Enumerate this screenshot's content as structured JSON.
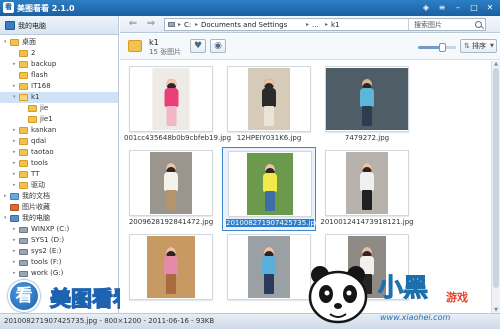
{
  "app": {
    "title": "美图看看 2.1.0",
    "logo_text": "看"
  },
  "window_controls": [
    {
      "name": "skin-icon",
      "glyph": "◈"
    },
    {
      "name": "menu-icon",
      "glyph": "≡"
    },
    {
      "name": "minimize-icon",
      "glyph": "–"
    },
    {
      "name": "maximize-icon",
      "glyph": "□"
    },
    {
      "name": "close-icon",
      "glyph": "✕"
    }
  ],
  "sidebar": {
    "header": "我的电脑",
    "tree": [
      {
        "label": "桌面",
        "depth": 0,
        "expander": "▾",
        "icon": "folder"
      },
      {
        "label": "2",
        "depth": 1,
        "expander": "",
        "icon": "folder"
      },
      {
        "label": "backup",
        "depth": 1,
        "expander": "▸",
        "icon": "folder"
      },
      {
        "label": "flash",
        "depth": 1,
        "expander": "",
        "icon": "folder"
      },
      {
        "label": "IT168",
        "depth": 1,
        "expander": "▸",
        "icon": "folder"
      },
      {
        "label": "k1",
        "depth": 1,
        "expander": "▾",
        "icon": "folder-open",
        "selected": true
      },
      {
        "label": "jie",
        "depth": 2,
        "expander": "",
        "icon": "folder"
      },
      {
        "label": "jie1",
        "depth": 2,
        "expander": "",
        "icon": "folder"
      },
      {
        "label": "kankan",
        "depth": 1,
        "expander": "▸",
        "icon": "folder"
      },
      {
        "label": "qdai",
        "depth": 1,
        "expander": "▸",
        "icon": "folder"
      },
      {
        "label": "taotao",
        "depth": 1,
        "expander": "▸",
        "icon": "folder"
      },
      {
        "label": "tools",
        "depth": 1,
        "expander": "▸",
        "icon": "folder"
      },
      {
        "label": "TT",
        "depth": 1,
        "expander": "▸",
        "icon": "folder"
      },
      {
        "label": "驱动",
        "depth": 1,
        "expander": "▸",
        "icon": "folder"
      },
      {
        "label": "我的文档",
        "depth": 0,
        "expander": "▸",
        "icon": "doc"
      },
      {
        "label": "图片收藏",
        "depth": 0,
        "expander": "",
        "icon": "special"
      },
      {
        "label": "我的电脑",
        "depth": 0,
        "expander": "▾",
        "icon": "computer"
      },
      {
        "label": "WINXP (C:)",
        "depth": 1,
        "expander": "▸",
        "icon": "drive"
      },
      {
        "label": "SYS1 (D:)",
        "depth": 1,
        "expander": "▸",
        "icon": "drive"
      },
      {
        "label": "sys2 (E:)",
        "depth": 1,
        "expander": "▸",
        "icon": "drive"
      },
      {
        "label": "tools (F:)",
        "depth": 1,
        "expander": "▸",
        "icon": "drive"
      },
      {
        "label": "work (G:)",
        "depth": 1,
        "expander": "▸",
        "icon": "drive"
      }
    ]
  },
  "brand": {
    "badge": "看",
    "text": "美图看看"
  },
  "toolbar": {
    "back_glyph": "⇐",
    "forward_glyph": "⇒",
    "breadcrumbs": [
      "C:",
      "Documents and Settings",
      "...",
      "k1"
    ],
    "breadcrumb_sep": "▸",
    "search_placeholder": "搜索图片"
  },
  "folder_info": {
    "name": "k1",
    "count": "15 张图片",
    "favorite_glyph": "♥",
    "view_glyph": "◉",
    "zoom_level": 0.62,
    "sort_glyph": "⇅",
    "sort_label": "排序",
    "sort_caret": "▼"
  },
  "thumbnails": [
    {
      "filename": "001cc435648b0b9cbfeb19.jpg",
      "selected": false,
      "aspect": 0.58,
      "bg": "#eeeae6",
      "skin": "#f0c8b0",
      "top": "#e8407a",
      "bottom": "#f2b6c6"
    },
    {
      "filename": "12HPEIY031K6.jpg",
      "selected": false,
      "aspect": 0.66,
      "bg": "#d6cbb8",
      "skin": "#eec3a8",
      "top": "#2d2a2c",
      "bottom": "#e9e3d8"
    },
    {
      "filename": "7479272.jpg",
      "selected": false,
      "aspect": 1.35,
      "bg": "#4f5d66",
      "skin": "#d9b49c",
      "top": "#5cb6d8",
      "bottom": "#2c3d52"
    },
    {
      "filename": "2009628192841472.jpg",
      "selected": false,
      "aspect": 0.66,
      "bg": "#9a968e",
      "skin": "#e9c2a8",
      "top": "#f5f2ec",
      "bottom": "#b6946c"
    },
    {
      "filename": "2010082719074257​35.jpg",
      "selected": true,
      "aspect": 0.72,
      "bg": "#6c9a4c",
      "skin": "#eac4a6",
      "top": "#f3e94a",
      "bottom": "#3e6ea8"
    },
    {
      "filename": "2010012414739181​21.jpg",
      "selected": false,
      "aspect": 0.66,
      "bg": "#b7b3ac",
      "skin": "#eec3a8",
      "top": "#f2f0ee",
      "bottom": "#1f1f24"
    },
    {
      "filename": "",
      "selected": false,
      "aspect": 0.75,
      "bg": "#c69a62",
      "skin": "#e9c0a2",
      "top": "#e58aa8",
      "bottom": "#a86a3e"
    },
    {
      "filename": "",
      "selected": false,
      "aspect": 0.66,
      "bg": "#9aa0a4",
      "skin": "#eec3a8",
      "top": "#5ab0d8",
      "bottom": "#2a3a5a"
    },
    {
      "filename": "",
      "selected": false,
      "aspect": 0.6,
      "bg": "#8f8a84",
      "skin": "#e6bea2",
      "top": "#f2f0ec",
      "bottom": "#262426"
    }
  ],
  "status": {
    "text": "2010082719074257​35.jpg - 800×1200 - 2011-06-16 - 93KB"
  },
  "watermark": {
    "text": "小黑",
    "sub": "游戏",
    "url": "www.xiaohei.com"
  }
}
